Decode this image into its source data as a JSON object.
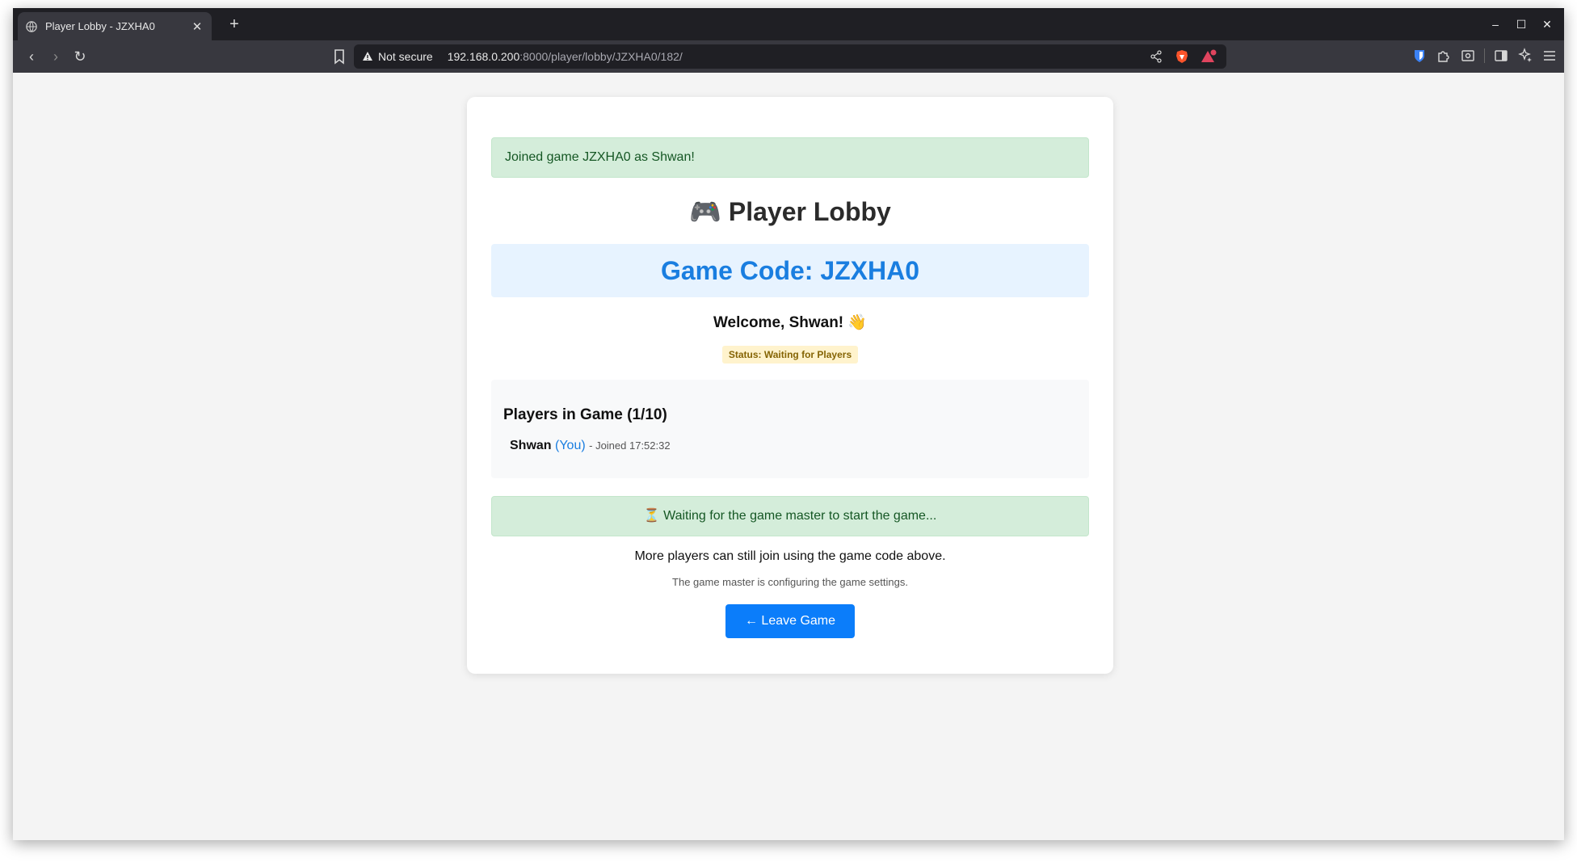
{
  "browser": {
    "tab_title": "Player Lobby - JZXHA0",
    "tab_close": "✕",
    "new_tab": "+",
    "security_label": "Not secure",
    "url_host": "192.168.0.200",
    "url_path": ":8000/player/lobby/JZXHA0/182/",
    "window_controls": {
      "minimize": "–",
      "maximize": "☐",
      "close": "✕"
    },
    "nav": {
      "back": "‹",
      "forward": "›",
      "reload": "↻"
    },
    "notification_count": "1"
  },
  "page": {
    "flash_message": "Joined game JZXHA0 as Shwan!",
    "title": "🎮 Player Lobby",
    "game_code": "Game Code: JZXHA0",
    "welcome": "Welcome, Shwan! 👋",
    "status": "Status: Waiting for Players",
    "players": {
      "heading": "Players in Game (1/10)",
      "list": [
        {
          "name": "Shwan",
          "you": "(You)",
          "joined": "- Joined 17:52:32"
        }
      ]
    },
    "waiting_message": "⏳ Waiting for the game master to start the game...",
    "more_players_note": "More players can still join using the game code above.",
    "configuring_note": "The game master is configuring the game settings.",
    "leave_button": "← Leave Game"
  },
  "colors": {
    "accent": "#0b7dfa",
    "code_text": "#1a7ee0",
    "success_bg": "#d4edda",
    "success_text": "#155724",
    "status_bg": "#fff3cd",
    "status_text": "#856404"
  }
}
